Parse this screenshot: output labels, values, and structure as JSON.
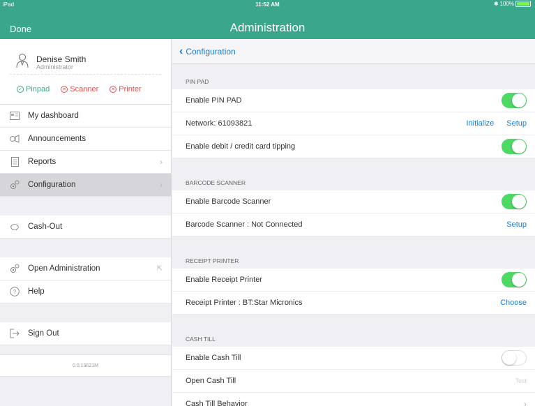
{
  "status_bar": {
    "carrier": "iPad",
    "time": "11:52 AM",
    "battery": "100%"
  },
  "header": {
    "done_label": "Done",
    "title": "Administration"
  },
  "user": {
    "name": "Denise Smith",
    "role": "Administrator"
  },
  "devices": [
    {
      "label": "Pinpad",
      "state": "ok",
      "icon": "check"
    },
    {
      "label": "Scanner",
      "state": "error",
      "icon": "x"
    },
    {
      "label": "Printer",
      "state": "error",
      "icon": "x"
    }
  ],
  "sidebar": {
    "items": [
      {
        "label": "My dashboard",
        "icon": "dashboard-icon"
      },
      {
        "label": "Announcements",
        "icon": "announcements-icon"
      },
      {
        "label": "Reports",
        "icon": "reports-icon"
      },
      {
        "label": "Configuration",
        "icon": "gear-icon"
      }
    ],
    "cash_out": {
      "label": "Cash-Out"
    },
    "open_admin": {
      "label": "Open Administration"
    },
    "help": {
      "label": "Help"
    },
    "sign_out": {
      "label": "Sign Out"
    },
    "version": "0.0.19621M"
  },
  "main": {
    "back_label": "Configuration",
    "sections": {
      "pin_pad": {
        "header": "PIN PAD",
        "enable_label": "Enable PIN PAD",
        "enable_on": true,
        "network_label": "Network: 61093821",
        "initialize_label": "Initialize",
        "setup_label": "Setup",
        "tipping_label": "Enable debit / credit card tipping",
        "tipping_on": true
      },
      "barcode": {
        "header": "BARCODE SCANNER",
        "enable_label": "Enable Barcode Scanner",
        "enable_on": true,
        "status_label": "Barcode Scanner : Not Connected",
        "setup_label": "Setup"
      },
      "receipt": {
        "header": "RECEIPT PRINTER",
        "enable_label": "Enable Receipt Printer",
        "enable_on": true,
        "status_label": "Receipt Printer : BT:Star Micronics",
        "choose_label": "Choose"
      },
      "cash_till": {
        "header": "CASH TILL",
        "enable_label": "Enable Cash Till",
        "enable_on": false,
        "open_label": "Open Cash Till",
        "test_label": "Test",
        "behavior_label": "Cash Till Behavior"
      }
    }
  },
  "colors": {
    "brand": "#3aa78d",
    "link": "#1a7bd6",
    "toggle_on": "#4cd964",
    "error": "#e2514f"
  }
}
